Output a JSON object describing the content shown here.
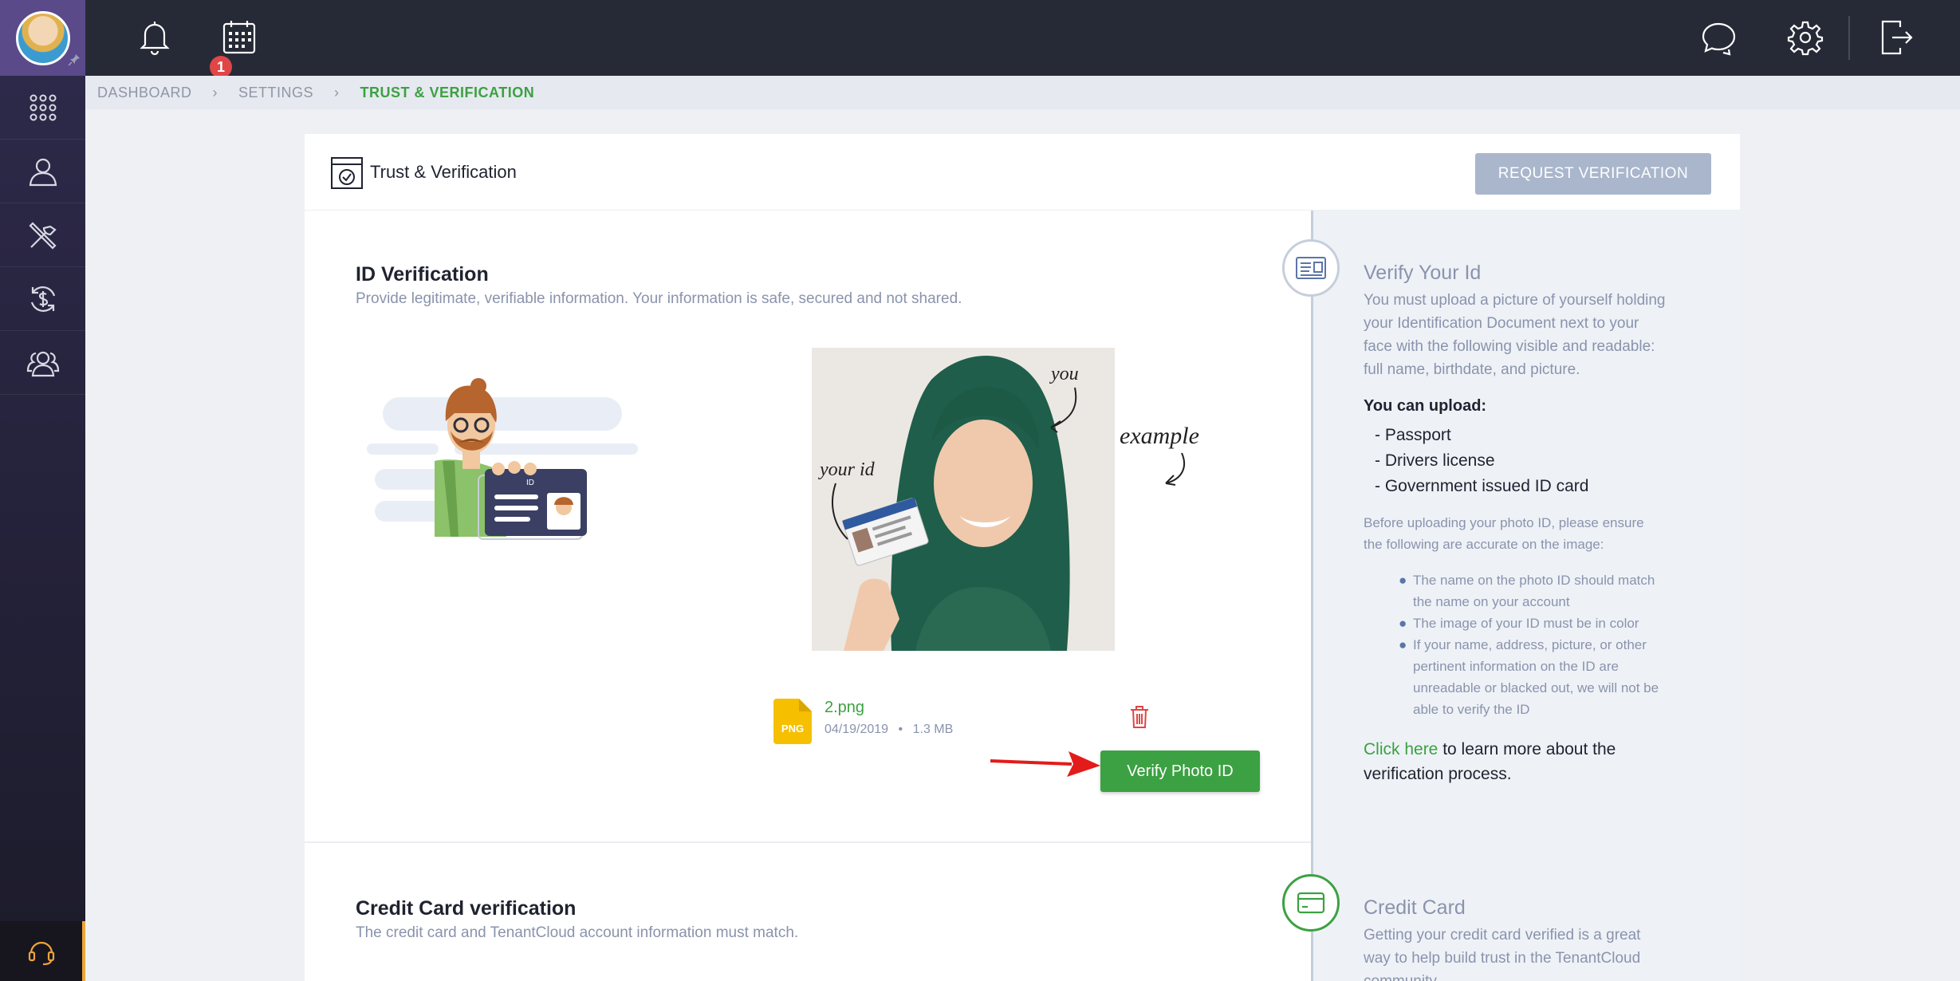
{
  "topbar": {
    "notification_count": "1"
  },
  "breadcrumb": {
    "items": [
      "DASHBOARD",
      "SETTINGS",
      "TRUST & VERIFICATION"
    ]
  },
  "card": {
    "title": "Trust & Verification",
    "request_button": "REQUEST VERIFICATION"
  },
  "id_verification": {
    "title": "ID Verification",
    "subtitle": "Provide legitimate, verifiable information. Your information is safe, secured and not shared.",
    "example_labels": {
      "you": "you",
      "example": "example",
      "your_id": "your id"
    },
    "file": {
      "name": "2.png",
      "type_badge": "PNG",
      "date": "04/19/2019",
      "bullet": "•",
      "size": "1.3 MB"
    },
    "id_card_label": "ID",
    "verify_button": "Verify Photo ID"
  },
  "verify_panel": {
    "title": "Verify Your Id",
    "lines": [
      "You must upload a picture of yourself holding",
      "your Identification Document next to your",
      "face with the following visible and readable:",
      "full name, birthdate, and picture."
    ],
    "can_upload_label": "You can upload:",
    "upload_options": [
      "- Passport",
      "- Drivers license",
      "- Government issued ID card"
    ],
    "ensure_lines": [
      "Before uploading your photo ID, please ensure",
      "the following are accurate on the image:"
    ],
    "checklist": [
      [
        "The name on the photo ID should match",
        "the name on your account"
      ],
      [
        "The image of your ID must be in color"
      ],
      [
        "If your name, address, picture, or other",
        "pertinent information on the ID are",
        "unreadable or blacked out, we will not be",
        "able to verify the ID"
      ]
    ],
    "click_here": "Click here",
    "learn_more_lines": [
      " to learn more about the",
      "verification process."
    ]
  },
  "credit_card": {
    "title": "Credit Card verification",
    "subtitle": "The credit card and TenantCloud account information must match.",
    "panel_title": "Credit Card",
    "panel_lines": [
      "Getting your credit card verified is a great",
      "way to help build trust in the TenantCloud",
      "community."
    ]
  },
  "colors": {
    "accent_green": "#3ca142",
    "sidebar": "#2e2a4c",
    "topbar": "#262a36",
    "disabled_button": "#a9b6cc",
    "red_arrow": "#e31b1b"
  }
}
